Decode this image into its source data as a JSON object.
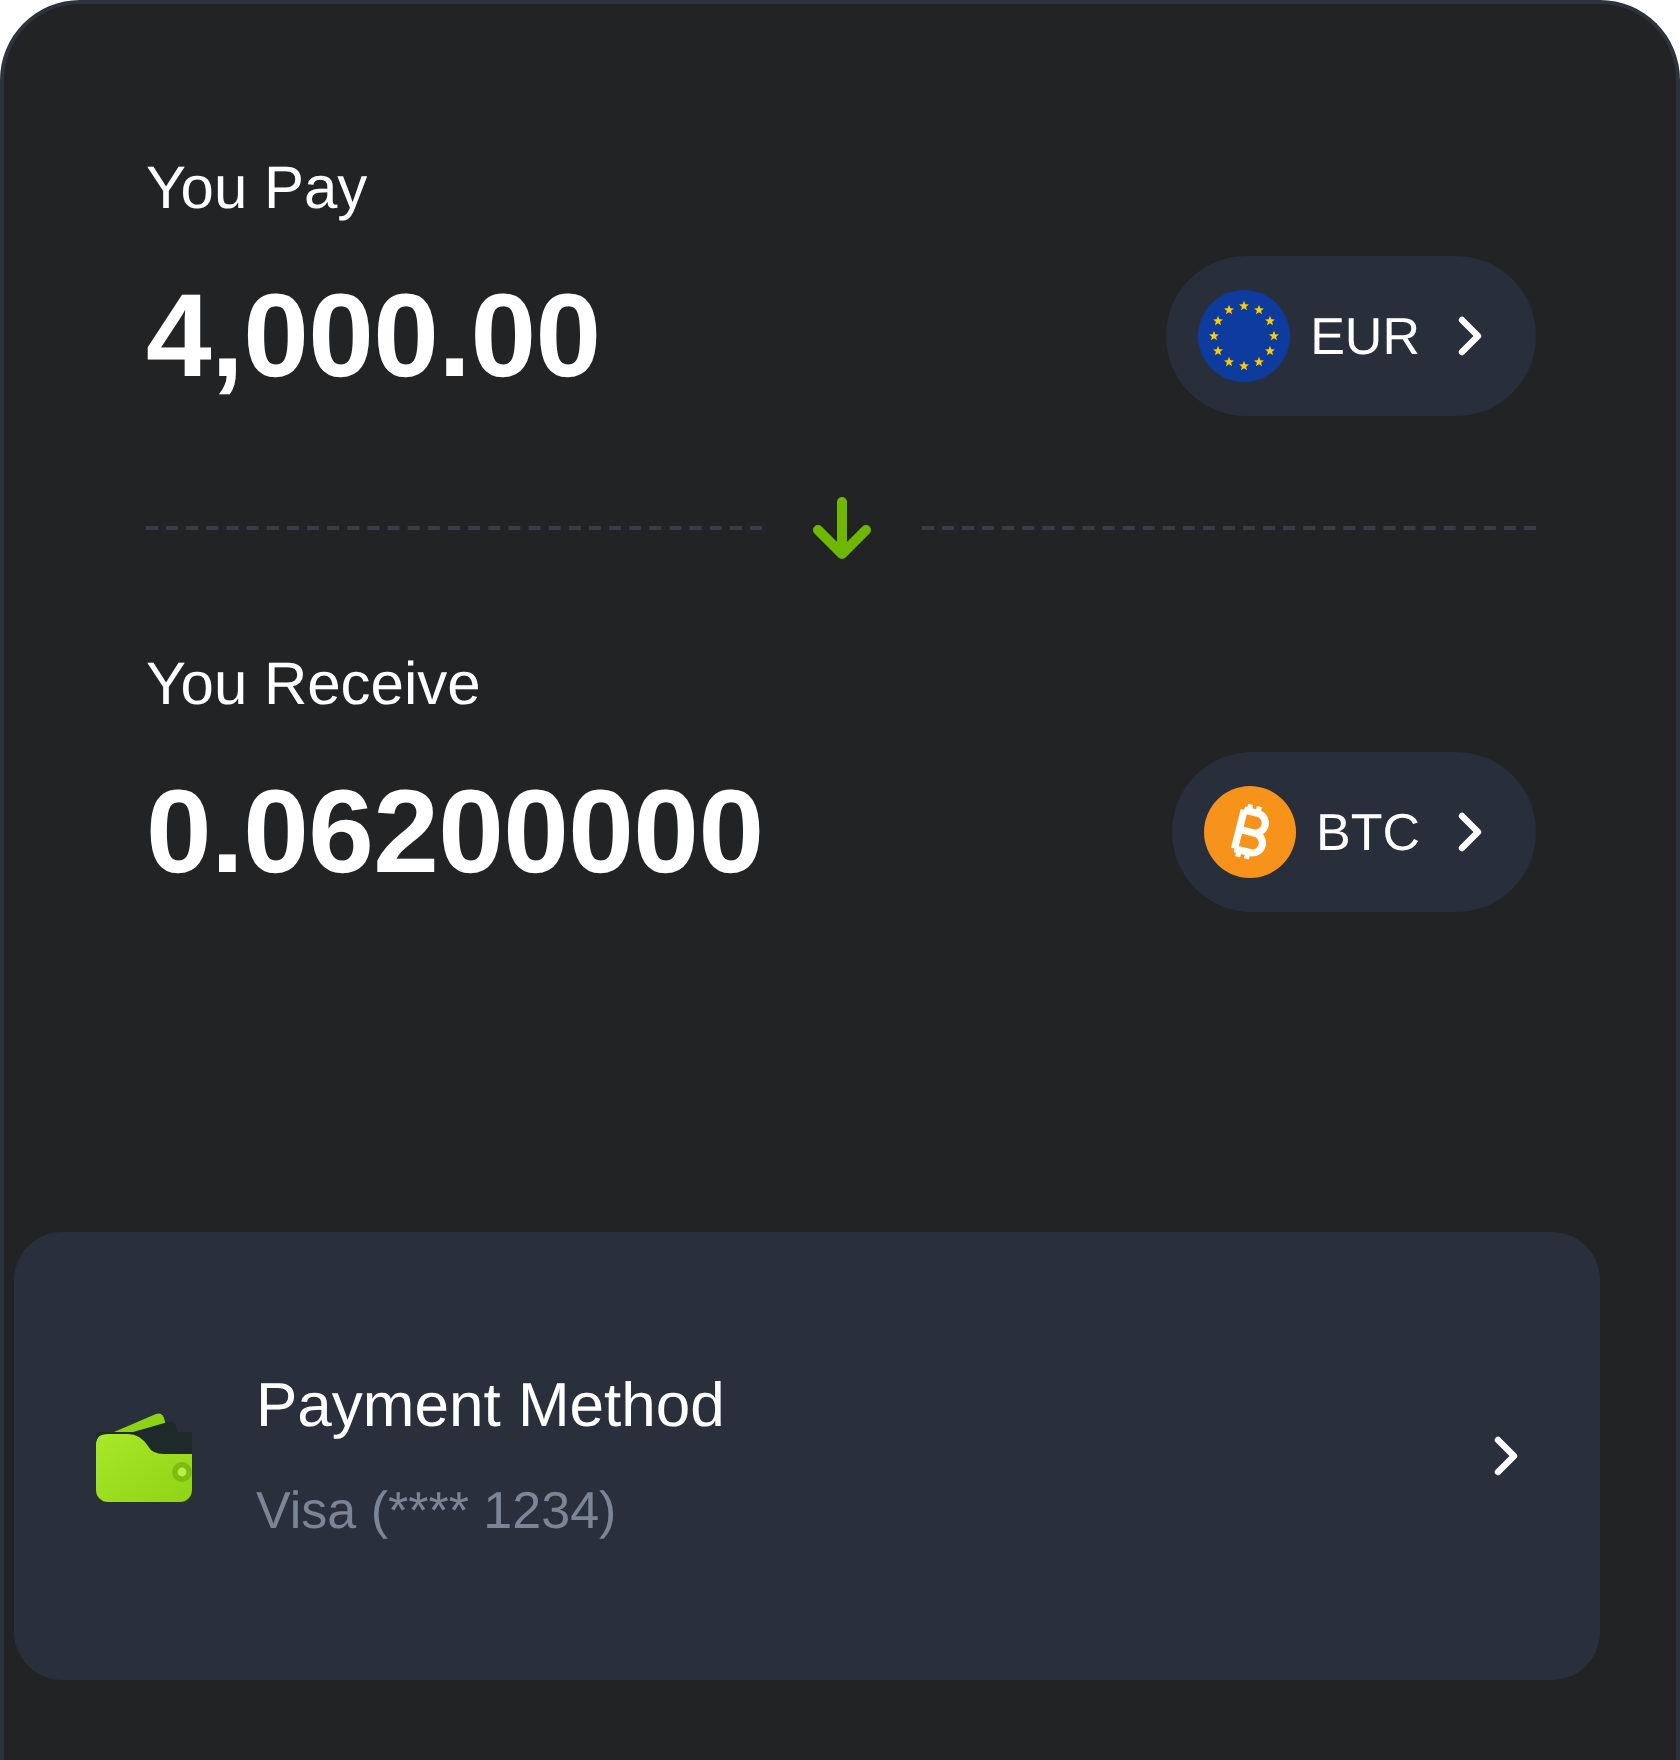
{
  "sections": [
    {
      "label": "You Pay",
      "amount": "4,000.00",
      "currency": {
        "kind": "eur",
        "code": "EUR"
      }
    },
    {
      "label": "You Receive",
      "amount": "0.06200000",
      "currency": {
        "kind": "btc",
        "code": "BTC"
      }
    }
  ],
  "payment_method": {
    "title": "Payment Method",
    "detail": "Visa (**** 1234)"
  }
}
